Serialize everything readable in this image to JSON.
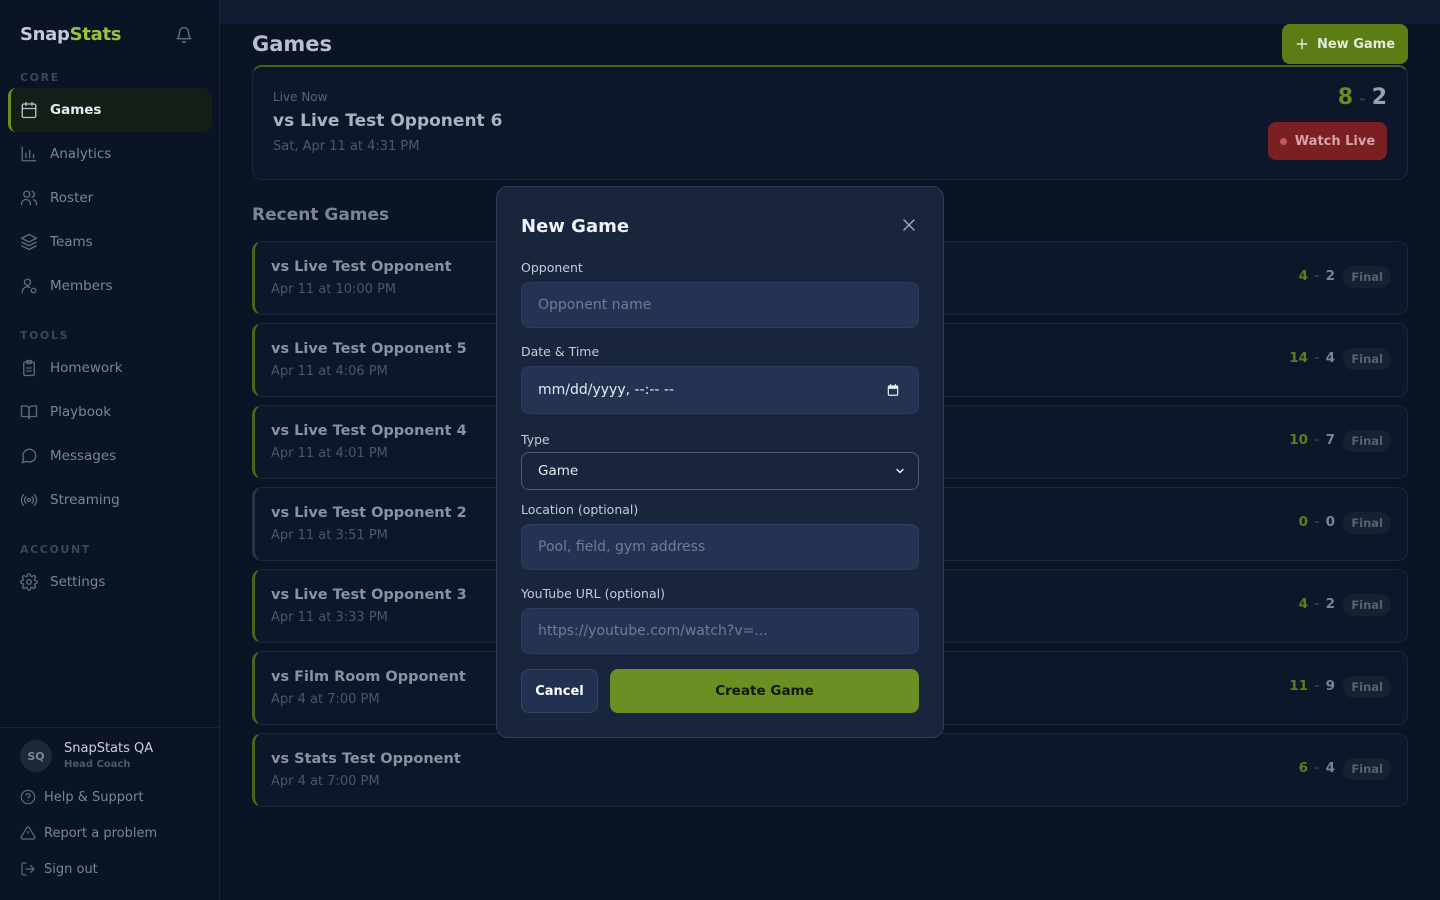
{
  "brand": {
    "part1": "Snap",
    "part2": "Stats"
  },
  "sidebar": {
    "sections": {
      "core": "CORE",
      "tools": "TOOLS",
      "account": "ACCOUNT"
    },
    "items": [
      {
        "label": "Games",
        "icon": "calendar-icon",
        "active": true
      },
      {
        "label": "Analytics",
        "icon": "bar-chart-icon"
      },
      {
        "label": "Roster",
        "icon": "users-icon"
      },
      {
        "label": "Teams",
        "icon": "layers-icon"
      },
      {
        "label": "Members",
        "icon": "user-cog-icon"
      },
      {
        "label": "Homework",
        "icon": "clipboard-icon"
      },
      {
        "label": "Playbook",
        "icon": "book-icon"
      },
      {
        "label": "Messages",
        "icon": "message-icon"
      },
      {
        "label": "Streaming",
        "icon": "broadcast-icon"
      },
      {
        "label": "Settings",
        "icon": "gear-icon"
      }
    ],
    "user": {
      "initials": "SQ",
      "name": "SnapStats QA",
      "role": "Head Coach"
    },
    "links": {
      "help": "Help & Support",
      "report": "Report a problem",
      "signout": "Sign out"
    }
  },
  "header": {
    "title": "Games",
    "new_game_label": "New Game"
  },
  "live": {
    "tag": "Live Now",
    "title": "vs Live Test Opponent 6",
    "date": "Sat, Apr 11 at 4:31 PM",
    "score_home": "8",
    "score_sep": "-",
    "score_away": "2",
    "watch_label": "Watch Live"
  },
  "recent": {
    "title": "Recent Games",
    "status_label": "Final",
    "games": [
      {
        "title": "vs Live Test Opponent",
        "date": "Apr 11 at 10:00 PM",
        "home": "4",
        "away": "2"
      },
      {
        "title": "vs Live Test Opponent 5",
        "date": "Apr 11 at 4:06 PM",
        "home": "14",
        "away": "4"
      },
      {
        "title": "vs Live Test Opponent 4",
        "date": "Apr 11 at 4:01 PM",
        "home": "10",
        "away": "7"
      },
      {
        "title": "vs Live Test Opponent 2",
        "date": "Apr 11 at 3:51 PM",
        "home": "0",
        "away": "0"
      },
      {
        "title": "vs Live Test Opponent 3",
        "date": "Apr 11 at 3:33 PM",
        "home": "4",
        "away": "2"
      },
      {
        "title": "vs Film Room Opponent",
        "date": "Apr 4 at 7:00 PM",
        "home": "11",
        "away": "9"
      },
      {
        "title": "vs Stats Test Opponent",
        "date": "Apr 4 at 7:00 PM",
        "home": "6",
        "away": "4"
      }
    ]
  },
  "modal": {
    "title": "New Game",
    "opponent_label": "Opponent",
    "opponent_placeholder": "Opponent name",
    "datetime_label": "Date & Time",
    "datetime_value": "mm/dd/yyyy, --:-- --",
    "type_label": "Type",
    "type_value": "Game",
    "location_label": "Location (optional)",
    "location_placeholder": "Pool, field, gym address",
    "youtube_label": "YouTube URL (optional)",
    "youtube_placeholder": "https://youtube.com/watch?v=...",
    "cancel_label": "Cancel",
    "create_label": "Create Game"
  },
  "colors": {
    "accent": "#6c8f24",
    "brand_green": "#9cc23a",
    "live_red": "#7a1f22",
    "background": "#0b1424",
    "modal": "#18253d"
  }
}
